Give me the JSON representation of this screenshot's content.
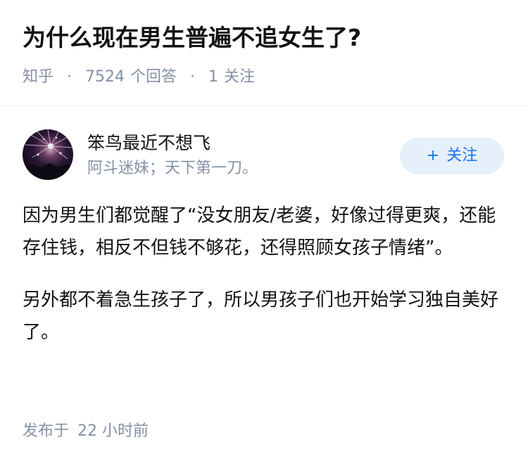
{
  "question": {
    "title": "为什么现在男生普遍不追女生了?",
    "source": "知乎",
    "answer_count": "7524",
    "answer_label": "个回答",
    "follow_count": "1",
    "follow_label": "关注"
  },
  "author": {
    "name": "笨鸟最近不想飞",
    "bio": "阿斗迷妹；天下第一刀。",
    "follow_button": "关注",
    "follow_icon": "plus-icon"
  },
  "answer": {
    "paragraphs": [
      "因为男生们都觉醒了“没女朋友/老婆，好像过得更爽，还能存住钱，相反不但钱不够花，还得照顾女孩子情绪”。",
      "另外都不着急生孩子了，所以男孩子们也开始学习独自美好了。"
    ],
    "published_label": "发布于",
    "published_time": "22 小时前"
  },
  "colors": {
    "text": "#121212",
    "muted": "#8590a6",
    "accent": "#1772f6",
    "button_bg": "#e6f0fa"
  }
}
